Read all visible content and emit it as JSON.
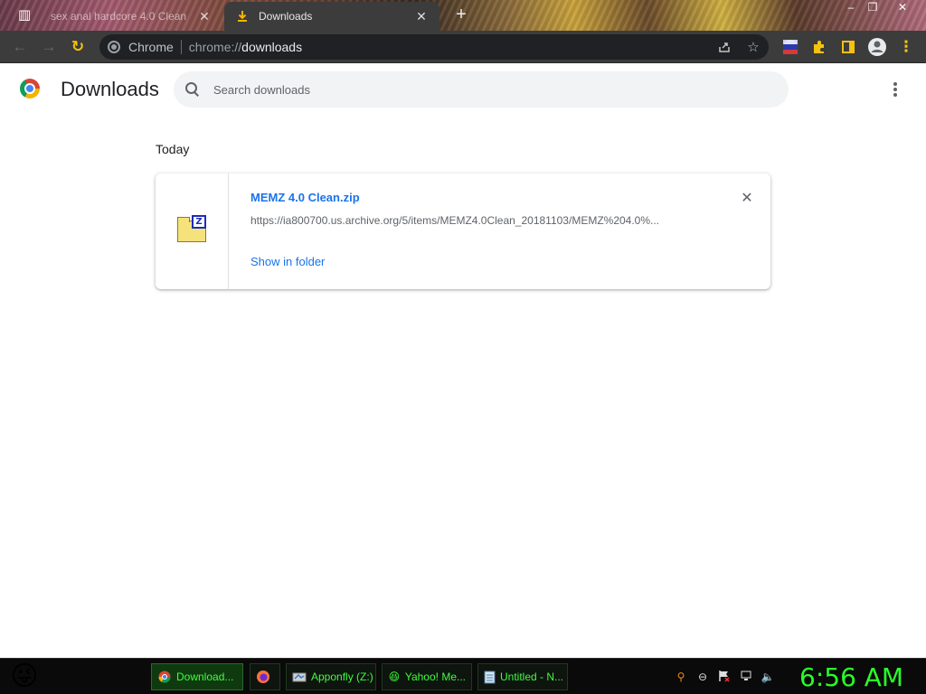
{
  "window": {
    "tabs": [
      {
        "title": "sex anal hardcore 4.0 Clean",
        "close": "✕"
      },
      {
        "title": "Downloads",
        "close": "✕"
      }
    ],
    "new_tab": "+",
    "controls": {
      "minimize": "‒",
      "maximize": "❐",
      "close": "✕"
    }
  },
  "toolbar": {
    "back": "←",
    "forward": "→",
    "reload": "↻",
    "site_label": "Chrome",
    "url_prefix": "chrome://",
    "url_path": "downloads"
  },
  "page": {
    "title": "Downloads",
    "search_placeholder": "Search downloads",
    "date_heading": "Today",
    "downloads": [
      {
        "file_name": "MEMZ 4.0 Clean.zip",
        "url": "https://ia800700.us.archive.org/5/items/MEMZ4.0Clean_20181103/MEMZ%204.0%...",
        "action": "Show in folder",
        "close": "✕",
        "badge": "Z"
      }
    ]
  },
  "taskbar": {
    "start_icon": "😜",
    "tasks": [
      {
        "label": "Download...",
        "icon": "chrome-icon",
        "active": true
      },
      {
        "label": "",
        "icon": "firefox-icon",
        "active": false
      },
      {
        "label": "Apponfly (Z:)",
        "icon": "drive-icon",
        "active": false
      },
      {
        "label": "Yahoo! Me...",
        "icon": "yahoo-messenger-icon",
        "active": false
      },
      {
        "label": "Untitled - N...",
        "icon": "notepad-icon",
        "active": false
      }
    ],
    "clock": "6:56 AM"
  },
  "colors": {
    "accent_link": "#1a73e8",
    "taskbar_text": "#3dff3d",
    "clock": "#28ff28",
    "toolbar_bg": "#3c3c3c"
  }
}
